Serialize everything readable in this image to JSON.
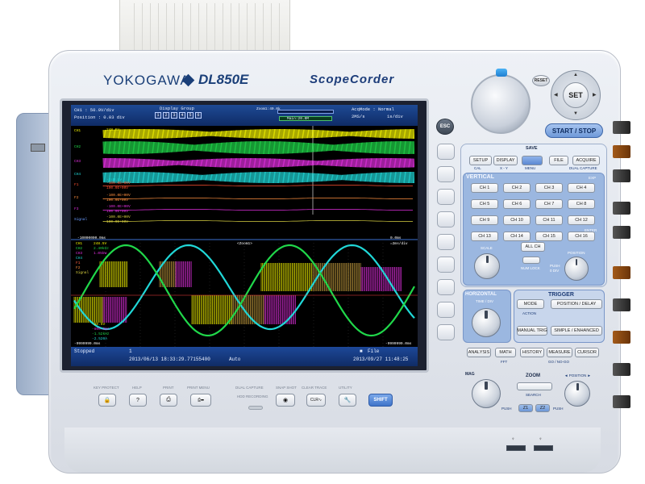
{
  "device": {
    "brand": "YOKOGAWA",
    "model": "DL850E",
    "series": "ScopeCorder",
    "accent": "#1a3f78"
  },
  "screen": {
    "header": {
      "ch1_scale": "CH1   : 50.0V/div",
      "position": "Position : 0.03 div",
      "display_group_label": "Display Group",
      "display_group_items": [
        "1",
        "2",
        "3",
        "4",
        "5",
        "6"
      ],
      "zoom1": "Zoom1:40.0k",
      "main_label": "Main:20.0M",
      "acq_mode": "AcqMode : Normal",
      "sample_rate": "2MS/s",
      "time_div": "1s/div"
    },
    "main_window_labels": {
      "ch1": "CH1",
      "ch2": "CH2",
      "ch3": "CH3",
      "ch4": "CH4",
      "f1": "F1",
      "f2": "F2",
      "f3": "F3",
      "signal": "Signal",
      "scale_top_1": "248.5V",
      "scale_bot_1": "-248.5V",
      "f1_top": "-100.0E+00V",
      "f1_bot": "100.0E+00V",
      "f2_top": "-100.0E+00V",
      "f2_bot": "100.0E+00V",
      "f3_top": "-100.0E+00V",
      "f3_bot": "100.0E+00V",
      "signal_top": "-100.0E+00V",
      "signal_bot": "100.0E+00V"
    },
    "zoom_window": {
      "left_time": "-10000000.0ms",
      "right_time": "0.0ms",
      "zoom_tag": "<Zoom1>",
      "time_div": "=2ms/div",
      "ch1_scale": "248.5V",
      "ch2_scale": "2.40kHz",
      "ch3_scale": "1.05kW",
      "ch1_label": "CH1",
      "ch2_label": "CH2",
      "ch3_label": "CH3",
      "ch4_label": "CH4",
      "f1_label": "F1",
      "f2_label": "F2",
      "signal_label": "Signal",
      "bottom_left_time": "-9999999.0ms",
      "bottom_right_time": "-9999999.0ms",
      "low1": "-80.5V",
      "low2": "-800.0mA",
      "low3": "-1.52kHz",
      "low4": "-2.520A"
    },
    "status": {
      "state": "Stopped",
      "count": "1",
      "timestamp_left": "2013/06/13 18:33:29.77155400",
      "trigger": "Auto",
      "file_label": "File",
      "timestamp_right": "2013/09/27 11:48:25"
    },
    "colors": {
      "ch1": "#f2f200",
      "ch2": "#20d84a",
      "ch3": "#e22fe0",
      "ch4": "#20d8d8",
      "sig": "#d8d040"
    }
  },
  "controls": {
    "reset": "RESET",
    "set": "SET",
    "esc": "ESC",
    "start_stop": "START / STOP",
    "row1": [
      "SETUP",
      "DISPLAY",
      "SAVE",
      "FILE",
      "ACQUIRE"
    ],
    "row1_sub": [
      "CAL",
      "X - Y",
      "MENU",
      "",
      "DUAL CAPTURE"
    ],
    "vertical": "VERTICAL",
    "exp": "EXP",
    "enter": "ENTER",
    "channels": [
      "CH 1",
      "CH 2",
      "CH 3",
      "CH 4",
      "CH 5",
      "CH 6",
      "CH 7",
      "CH 8",
      "CH 9",
      "CH 10",
      "CH 11",
      "CH 12",
      "CH 13",
      "CH 14",
      "CH 15",
      "CH 16"
    ],
    "scale": "SCALE",
    "all_ch": "ALL CH",
    "num_lock": "NUM LOCK",
    "position": "POSITION",
    "push": "PUSH",
    "zero_div": "0 DIV",
    "horizontal": "HORIZONTAL",
    "time_div": "TIME / DIV",
    "trigger": "TRIGGER",
    "mode": "MODE",
    "position_delay": "POSITION / DELAY",
    "action": "ACTION",
    "manual_trig": "MANUAL TRIG",
    "simple_enhanced": "SIMPLE / ENHANCED",
    "row3": [
      "ANALYSIS",
      "MATH",
      "HISTORY",
      "MEASURE",
      "CURSOR"
    ],
    "row3_sub": [
      "",
      "FFT",
      "",
      "GO / NO-GO",
      ""
    ],
    "mag": "MAG",
    "zoom": "ZOOM",
    "search": "SEARCH",
    "z1": "Z1",
    "z2": "Z2",
    "position_lr": "◄ POSITION ►",
    "bottom_labels": [
      "KEY PROTECT",
      "HELP",
      "PRINT",
      "PRINT MENU",
      "SNAP SHOT",
      "CLEAR TRACE",
      "UTILITY"
    ],
    "dual_capture": "DUAL CAPTURE",
    "hdd_recording": "HDD RECORDING",
    "shift": "SHIFT"
  }
}
